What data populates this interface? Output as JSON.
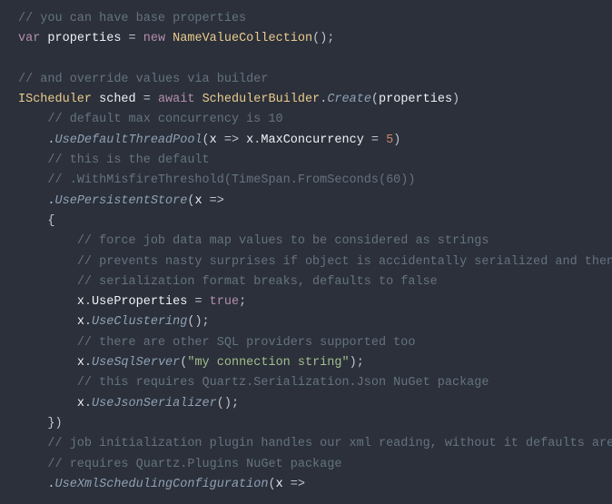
{
  "code": {
    "l1_c": "// you can have base properties",
    "l2_kw1": "var",
    "l2_id1": "properties",
    "l2_op1": " = ",
    "l2_kw2": "new",
    "l2_tp1": "NameValueCollection",
    "l2_p": "();",
    "l4_c": "// and override values via builder",
    "l5_tp1": "IScheduler",
    "l5_id1": "sched",
    "l5_op1": " = ",
    "l5_kw1": "await",
    "l5_tp2": "SchedulerBuilder",
    "l5_dot": ".",
    "l5_mt1": "Create",
    "l5_p1": "(",
    "l5_id2": "properties",
    "l5_p2": ")",
    "l6_c": "// default max concurrency is 10",
    "l7_d": ".",
    "l7_mt": "UseDefaultThreadPool",
    "l7_p1": "(",
    "l7_id1": "x",
    "l7_op1": " => ",
    "l7_id2": "x",
    "l7_d2": ".",
    "l7_id3": "MaxConcurrency",
    "l7_op2": " = ",
    "l7_nm": "5",
    "l7_p2": ")",
    "l8_c": "// this is the default",
    "l9_c": "// .WithMisfireThreshold(TimeSpan.FromSeconds(60))",
    "l10_d": ".",
    "l10_mt": "UsePersistentStore",
    "l10_p1": "(",
    "l10_id": "x",
    "l10_op": " =>",
    "l11_b": "{",
    "l12_c": "// force job data map values to be considered as strings",
    "l13_c": "// prevents nasty surprises if object is accidentally serialized and then",
    "l14_c": "// serialization format breaks, defaults to false",
    "l15_id1": "x",
    "l15_d": ".",
    "l15_id2": "UseProperties",
    "l15_op": " = ",
    "l15_bl": "true",
    "l15_sc": ";",
    "l16_id1": "x",
    "l16_d": ".",
    "l16_mt": "UseClustering",
    "l16_p": "();",
    "l17_c": "// there are other SQL providers supported too",
    "l18_id1": "x",
    "l18_d": ".",
    "l18_mt": "UseSqlServer",
    "l18_p1": "(",
    "l18_st": "\"my connection string\"",
    "l18_p2": ");",
    "l19_c": "// this requires Quartz.Serialization.Json NuGet package",
    "l20_id1": "x",
    "l20_d": ".",
    "l20_mt": "UseJsonSerializer",
    "l20_p": "();",
    "l21_b": "})",
    "l22_c": "// job initialization plugin handles our xml reading, without it defaults are used",
    "l23_c": "// requires Quartz.Plugins NuGet package",
    "l24_d": ".",
    "l24_mt": "UseXmlSchedulingConfiguration",
    "l24_p1": "(",
    "l24_id": "x",
    "l24_op": " =>"
  }
}
